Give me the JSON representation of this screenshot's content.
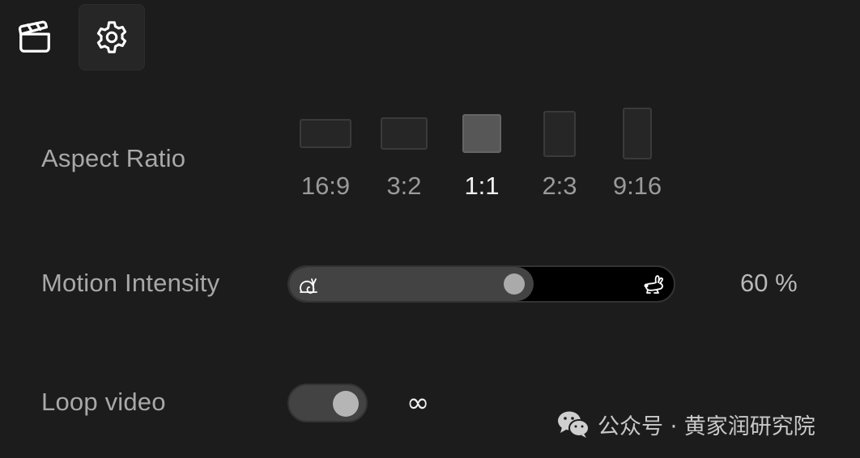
{
  "tabs": [
    {
      "icon": "clapperboard-icon",
      "active": false
    },
    {
      "icon": "gear-icon",
      "active": true
    }
  ],
  "aspect_ratio": {
    "label": "Aspect Ratio",
    "options": [
      "16:9",
      "3:2",
      "1:1",
      "2:3",
      "9:16"
    ],
    "selected": "1:1"
  },
  "motion_intensity": {
    "label": "Motion Intensity",
    "value_percent": 60,
    "value_text": "60 %",
    "left_icon": "snail-icon",
    "right_icon": "rabbit-icon"
  },
  "loop_video": {
    "label": "Loop video",
    "enabled": true,
    "symbol": "∞"
  },
  "watermark": {
    "text": "公众号 · 黄家润研究院",
    "icon": "wechat-icon"
  },
  "colors": {
    "background": "#1c1c1c",
    "selected_text": "#f2f2f2",
    "muted_text": "#9a9a9a"
  }
}
